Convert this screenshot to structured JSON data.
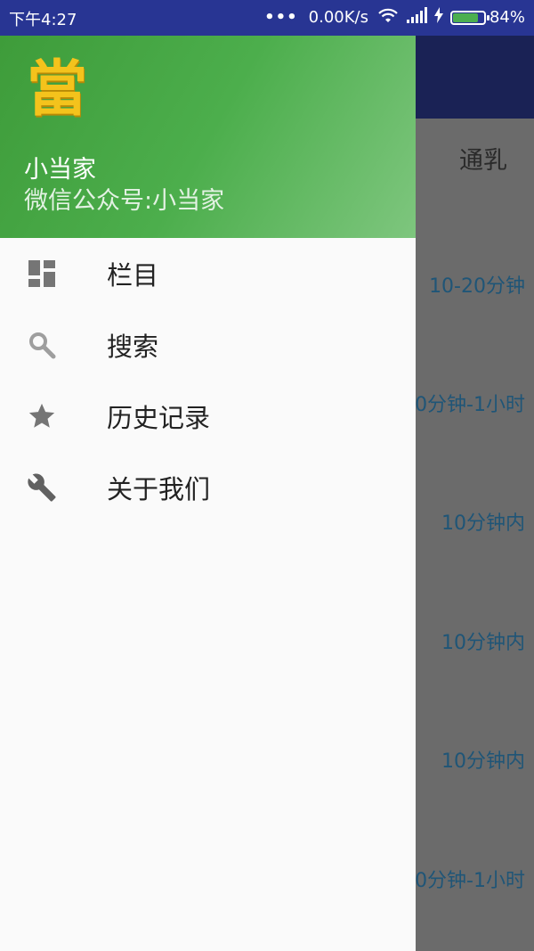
{
  "status_bar": {
    "time": "下午4:27",
    "dots": "•••",
    "network_speed": "0.00K/s",
    "battery_percent": "84%",
    "battery_level": 0.84
  },
  "background": {
    "tab_label": "通乳",
    "rows": [
      "10-20分钟",
      "0分钟-1小时",
      "10分钟内",
      "10分钟内",
      "10分钟内",
      "0分钟-1小时"
    ]
  },
  "drawer": {
    "header": {
      "logo_text": "當",
      "name": "小当家",
      "subtitle": "微信公众号:小当家"
    },
    "items": [
      {
        "label": "栏目",
        "icon": "dashboard-icon"
      },
      {
        "label": "搜索",
        "icon": "search-icon"
      },
      {
        "label": "历史记录",
        "icon": "star-icon"
      },
      {
        "label": "关于我们",
        "icon": "wrench-icon"
      }
    ]
  },
  "colors": {
    "status_bar": "#283593",
    "header_green": "#4caf50",
    "logo_gold": "#f4c31c",
    "icon_gray": "#757575"
  }
}
